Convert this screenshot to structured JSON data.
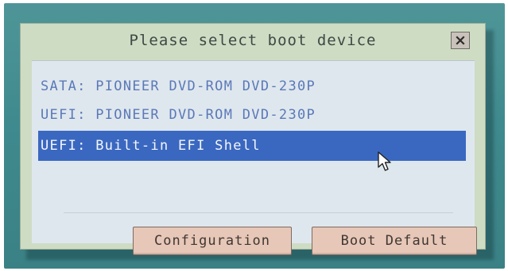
{
  "dialog": {
    "title": "Please select boot device",
    "close_icon": "close-icon"
  },
  "boot_devices": [
    {
      "label": "SATA: PIONEER DVD-ROM DVD-230P",
      "selected": false
    },
    {
      "label": "UEFI: PIONEER DVD-ROM DVD-230P",
      "selected": false
    },
    {
      "label": "UEFI: Built-in EFI Shell",
      "selected": true
    }
  ],
  "buttons": {
    "configuration_label": "Configuration",
    "boot_default_label": "Boot Default"
  },
  "colors": {
    "background": "#3f8a8e",
    "dialog": "#cfdcc4",
    "list_background": "#dfe7ee",
    "item_text": "#5a79b8",
    "selection": "#3a68c0",
    "button": "#e7c7b7"
  },
  "icons": {
    "cursor": "mouse-pointer-icon"
  }
}
